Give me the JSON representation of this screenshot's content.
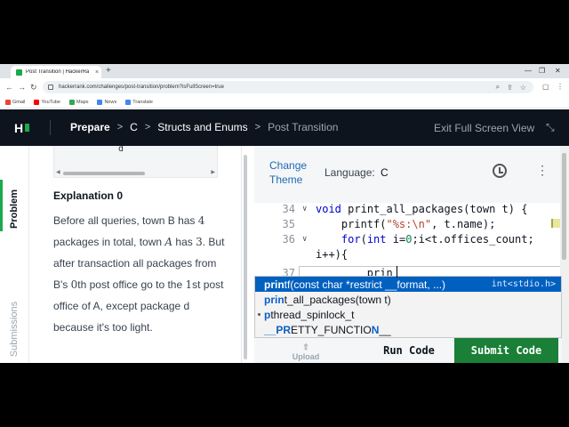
{
  "browser": {
    "tab_title": "Post Transition | HackerRank",
    "tab_close": "×",
    "new_tab": "+",
    "url": "hackerrank.com/challenges/post-transition/problem?isFullScreen=true",
    "bookmarks": [
      {
        "label": "Gmail",
        "color": "#ea4335"
      },
      {
        "label": "YouTube",
        "color": "#ff0000"
      },
      {
        "label": "Maps",
        "color": "#34a853"
      },
      {
        "label": "News",
        "color": "#4285f4"
      },
      {
        "label": "Translate",
        "color": "#4285f4"
      }
    ]
  },
  "header": {
    "logo_letter": "H",
    "breadcrumb": [
      "Prepare",
      "C",
      "Structs and Enums",
      "Post Transition"
    ],
    "exit_fullscreen": "Exit Full Screen View"
  },
  "sidebar": {
    "problem_tab": "Problem",
    "submissions_tab": "Submissions"
  },
  "problem": {
    "sample_tail": "d",
    "explanation_heading": "Explanation 0",
    "explanation": {
      "p1": "Before all queries, town B has ",
      "n1": "4",
      "p2": " packages in total, town ",
      "v1": "A",
      "p3": " has ",
      "n2": "3",
      "p4": ". But after transaction all packages from B's ",
      "n3": "0",
      "p5": "th post office go to the ",
      "n4": "1",
      "p6": "st post office of A, except package d because it's too light."
    }
  },
  "editor": {
    "change_theme": "Change Theme",
    "language_label": "Language:",
    "language_value": "C",
    "lines": [
      {
        "n": "34",
        "text": "void print_all_packages(town t) {"
      },
      {
        "n": "35",
        "text": "    printf(\"%s:\\n\", t.name);"
      },
      {
        "n": "36",
        "text": "    for(int i=0;i<t.offices_count;"
      },
      {
        "n": "",
        "text": "i++){"
      },
      {
        "n": "37",
        "text": "        prin"
      }
    ],
    "autocomplete": [
      {
        "match": "prin",
        "rest": "tf(const char *restrict __format, ...)",
        "detail": "int<stdio.h>"
      },
      {
        "match": "prin",
        "rest": "t_all_packages(town t)",
        "detail": ""
      },
      {
        "match": "p",
        "rest": "thread_spinlock_t",
        "detail": ""
      },
      {
        "match": "__PR",
        "rest": "ETTY_FUNCTIO",
        "tail_match": "N",
        "tail": "__",
        "detail": ""
      }
    ],
    "upload_label": "Upload",
    "run_label": "Run Code",
    "submit_label": "Submit Code"
  }
}
